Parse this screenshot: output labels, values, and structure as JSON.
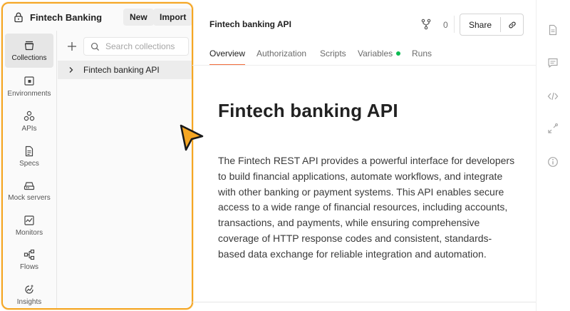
{
  "workspace": {
    "name": "Fintech Banking",
    "new_label": "New",
    "import_label": "Import",
    "highlight_color": "#f5a623"
  },
  "sidebar": {
    "items": [
      {
        "label": "Collections",
        "icon": "collections-icon",
        "active": true
      },
      {
        "label": "Environments",
        "icon": "environments-icon",
        "active": false
      },
      {
        "label": "APIs",
        "icon": "apis-icon",
        "active": false
      },
      {
        "label": "Specs",
        "icon": "specs-icon",
        "active": false
      },
      {
        "label": "Mock servers",
        "icon": "mock-servers-icon",
        "active": false
      },
      {
        "label": "Monitors",
        "icon": "monitors-icon",
        "active": false
      },
      {
        "label": "Flows",
        "icon": "flows-icon",
        "active": false
      },
      {
        "label": "Insights",
        "icon": "insights-icon",
        "active": false
      }
    ]
  },
  "collections": {
    "search_placeholder": "Search collections",
    "items": [
      {
        "label": "Fintech banking API",
        "expanded": false
      }
    ]
  },
  "header": {
    "title": "Fintech banking API",
    "fork_count": "0",
    "share_label": "Share"
  },
  "tabs": [
    {
      "label": "Overview",
      "active": true
    },
    {
      "label": "Authorization",
      "active": false
    },
    {
      "label": "Scripts",
      "active": false
    },
    {
      "label": "Variables",
      "active": false,
      "status_dot": true
    },
    {
      "label": "Runs",
      "active": false
    }
  ],
  "overview": {
    "heading": "Fintech banking API",
    "description": "The Fintech REST API provides a powerful interface for developers to build financial applications, automate workflows, and integrate with other banking or payment systems. This API enables secure access to a wide range of financial resources, including accounts, transactions, and payments, while ensuring comprehensive coverage of HTTP response codes and consistent, standards-based data exchange for reliable integration and automation."
  },
  "right_rail": {
    "icons": [
      "documentation-icon",
      "comments-icon",
      "code-icon",
      "related-collections-icon",
      "info-icon"
    ]
  },
  "colors": {
    "accent": "#f26b3a",
    "status_green": "#0cbb52",
    "cursor": "#f5a623"
  }
}
